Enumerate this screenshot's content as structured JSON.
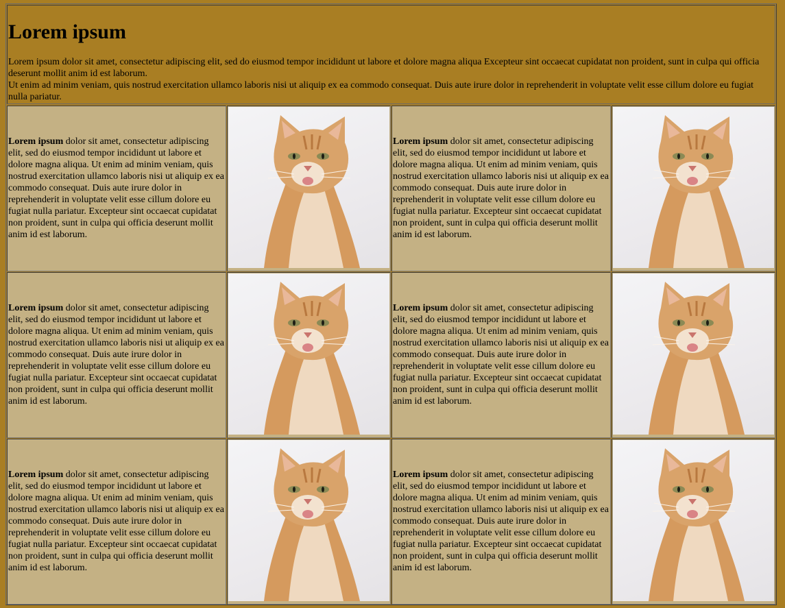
{
  "header": {
    "title": "Lorem ipsum",
    "intro_line1": "Lorem ipsum dolor sit amet, consectetur adipiscing elit, sed do eiusmod tempor incididunt ut labore et dolore magna aliqua Excepteur sint occaecat cupidatat non proident, sunt in culpa qui officia deserunt mollit anim id est laborum.",
    "intro_line2": "Ut enim ad minim veniam, quis nostrud exercitation ullamco laboris nisi ut aliquip ex ea commodo consequat. Duis aute irure dolor in reprehenderit in voluptate velit esse cillum dolore eu fugiat nulla pariatur."
  },
  "cell": {
    "lead": "Lorem ipsum",
    "body": " dolor sit amet, consectetur adipiscing elit, sed do eiusmod tempor incididunt ut labore et dolore magna aliqua. Ut enim ad minim veniam, quis nostrud exercitation ullamco laboris nisi ut aliquip ex ea commodo consequat. Duis aute irure dolor in reprehenderit in voluptate velit esse cillum dolore eu fugiat nulla pariatur. Excepteur sint occaecat cupidatat non proident, sunt in culpa qui officia deserunt mollit anim id est laborum."
  },
  "image": {
    "icon": "cat-photo",
    "colors": {
      "background": "#a97e23",
      "cell": "#c4b184",
      "fur": "#d9a36a",
      "fur_light": "#f1ddc6"
    }
  }
}
